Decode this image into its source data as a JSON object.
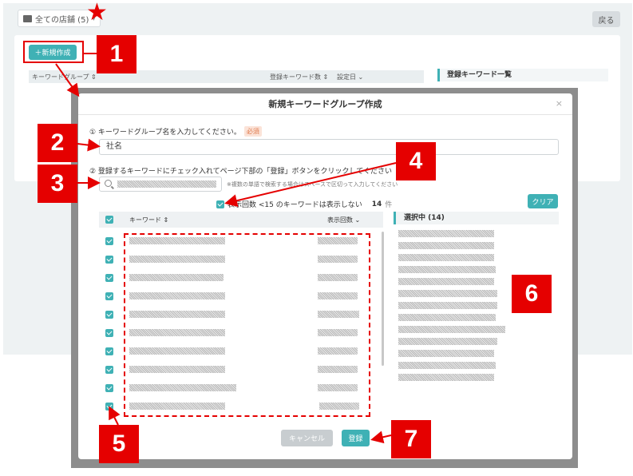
{
  "background": {
    "store_select": "全ての店舗 (5)",
    "back_button": "戻る",
    "new_button": "＋新規作成",
    "table_headers": [
      "キーワードグループ ⇕",
      "登録キーワード数 ⇕",
      "設定日 ⌄"
    ],
    "list_title": "登録キーワード一覧"
  },
  "modal": {
    "title": "新規キーワードグループ作成",
    "close": "×",
    "step1_label": "① キーワードグループ名を入力してください。",
    "required_badge": "必須",
    "group_name_value": "社名",
    "step2_label": "② 登録するキーワードにチェック入れてページ下部の「登録」ボタンをクリックしてください",
    "search_note": "※複数の単語で検索する場合はスペースで区切って入力してください",
    "filter_label": "表示回数 <15 のキーワードは表示しない",
    "count": "14",
    "count_unit": "件",
    "clear_button": "クリア",
    "col_keyword": "キーワード ⇕",
    "col_impressions": "表示回数 ⌄",
    "selected_title": "選択中 (14)",
    "cancel_button": "キャンセル",
    "register_button": "登録"
  },
  "annotations": [
    "1",
    "2",
    "3",
    "4",
    "5",
    "6",
    "7"
  ],
  "colors": {
    "accent": "#3fb1b5",
    "annotation": "#e50000"
  }
}
